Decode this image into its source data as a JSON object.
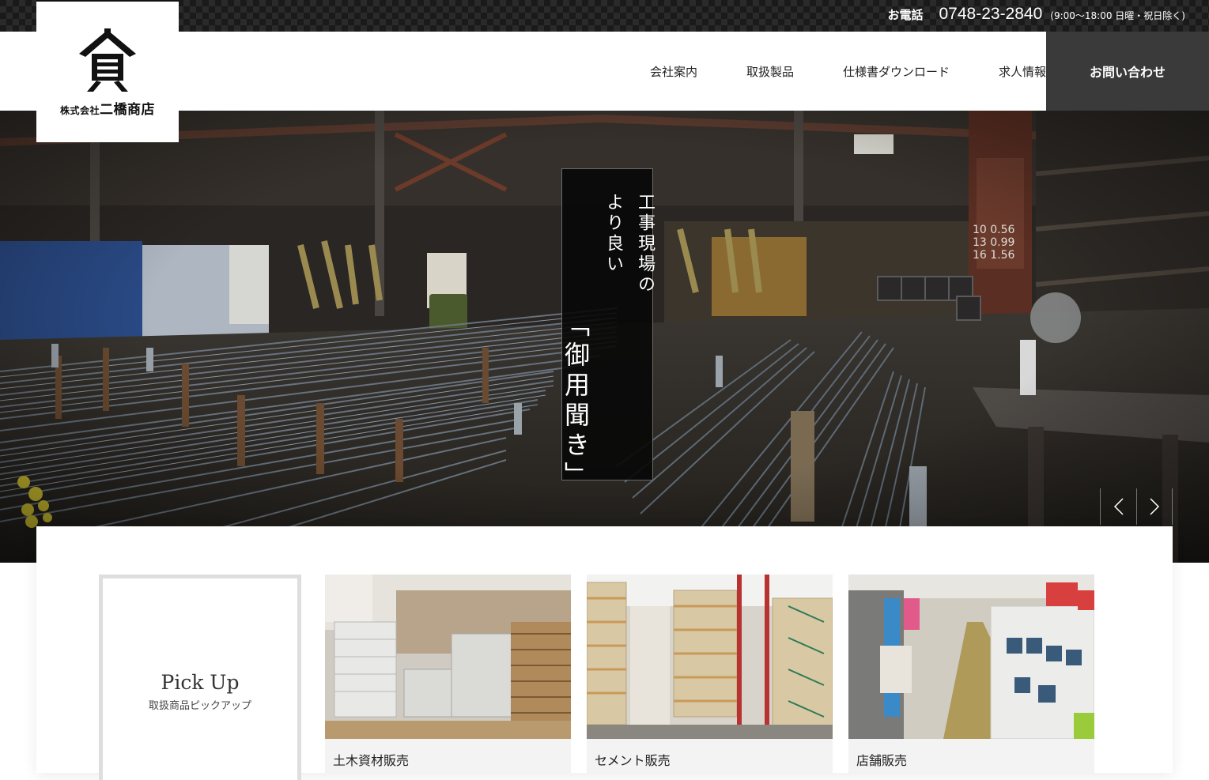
{
  "topbar": {
    "tel_label": "お電話",
    "tel_number": "0748-23-2840",
    "tel_hours": "(9:00〜18:00 日曜・祝日除く)"
  },
  "logo": {
    "mark": "貪",
    "company_prefix": "株式会社",
    "company_name": "二橋商店"
  },
  "nav": {
    "items": [
      {
        "label": "会社案内"
      },
      {
        "label": "取扱製品"
      },
      {
        "label": "仕様書ダウンロード"
      },
      {
        "label": "求人情報"
      }
    ],
    "contact_label": "お問い合わせ"
  },
  "hero": {
    "catch_lines": [
      "工事現場の",
      "より良い",
      "「御用聞き」"
    ],
    "prev_icon": "chevron-left-icon",
    "next_icon": "chevron-right-icon"
  },
  "pickup": {
    "title": "Pick Up",
    "subtitle": "取扱商品ピックアップ",
    "cards": [
      {
        "label": "土木資材販売"
      },
      {
        "label": "セメント販売"
      },
      {
        "label": "店舗販売"
      }
    ]
  },
  "colors": {
    "topbar": "#1a1a1a",
    "contact_button": "#3a3a3a",
    "card_bg": "#f3f3f3"
  }
}
